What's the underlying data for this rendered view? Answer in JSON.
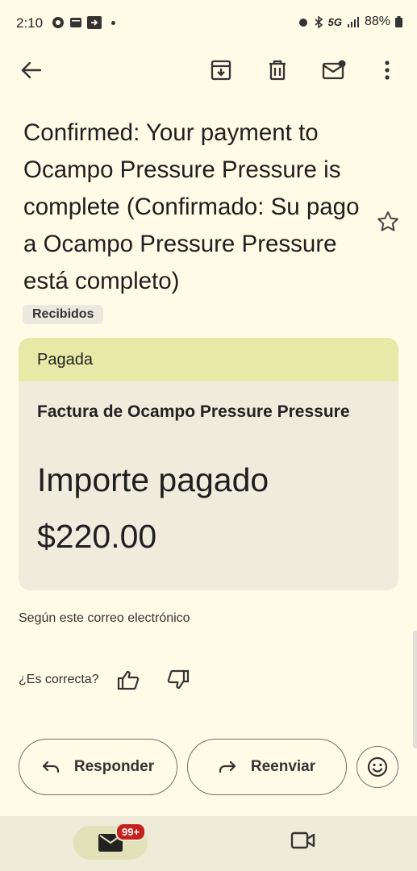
{
  "status_bar": {
    "time": "2:10",
    "battery": "88%",
    "network": "5G"
  },
  "toolbar": {
    "back": "back-arrow-icon",
    "archive": "archive-icon",
    "delete": "trash-icon",
    "mark_unread": "mark-unread-icon",
    "more": "more-vert-icon"
  },
  "email": {
    "subject": "Confirmed: Your payment to Ocampo Pressure Pressure is complete (Confirmado: Su pago a Ocampo Pressure Pressure está completo)",
    "label": "Recibidos"
  },
  "invoice_card": {
    "status": "Pagada",
    "title": "Factura de Ocampo Pressure Pressure",
    "amount_label": "Importe pagado",
    "amount": "$220.00",
    "header_color": "#e8e9a6",
    "card_color": "#efecdd"
  },
  "summary_note": "Según este correo electrónico",
  "feedback": {
    "question": "¿Es correcta?"
  },
  "actions": {
    "reply": "Responder",
    "forward": "Reenviar"
  },
  "bottom_nav": {
    "mail_badge": "99+",
    "badge_color": "#c5221f"
  }
}
